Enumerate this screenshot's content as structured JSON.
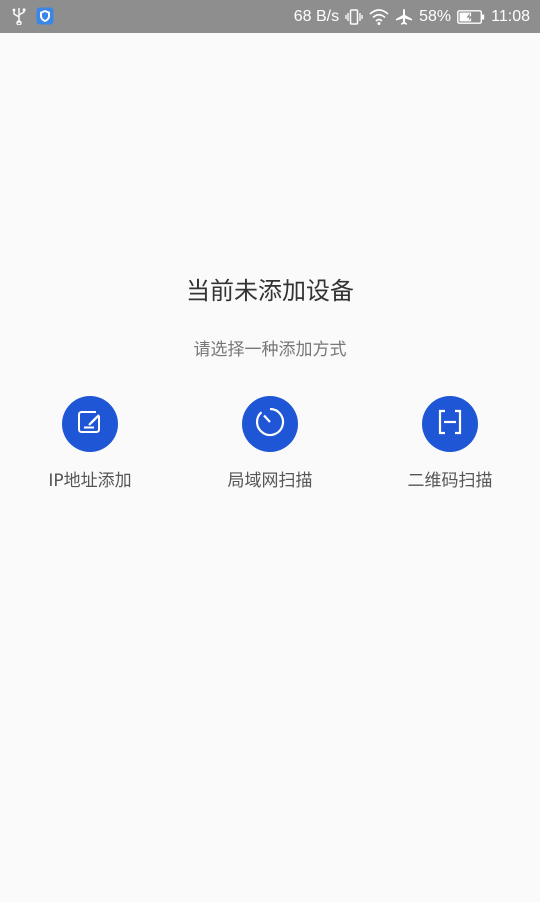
{
  "status_bar": {
    "net_speed": "68 B/s",
    "battery_percent": "58%",
    "time": "11:08",
    "icons": [
      "usb-icon",
      "shield-app-icon",
      "vibrate-icon",
      "wifi-icon",
      "airplane-icon",
      "battery-icon"
    ]
  },
  "empty_state": {
    "title": "当前未添加设备",
    "subtitle": "请选择一种添加方式"
  },
  "options": [
    {
      "label": "IP地址添加",
      "icon": "edit-icon"
    },
    {
      "label": "局域网扫描",
      "icon": "radar-scan-icon"
    },
    {
      "label": "二维码扫描",
      "icon": "qr-scan-icon"
    }
  ],
  "colors": {
    "accent": "#1e56d6",
    "status_bar_bg": "#8e8e8e",
    "background": "#fafafa"
  }
}
